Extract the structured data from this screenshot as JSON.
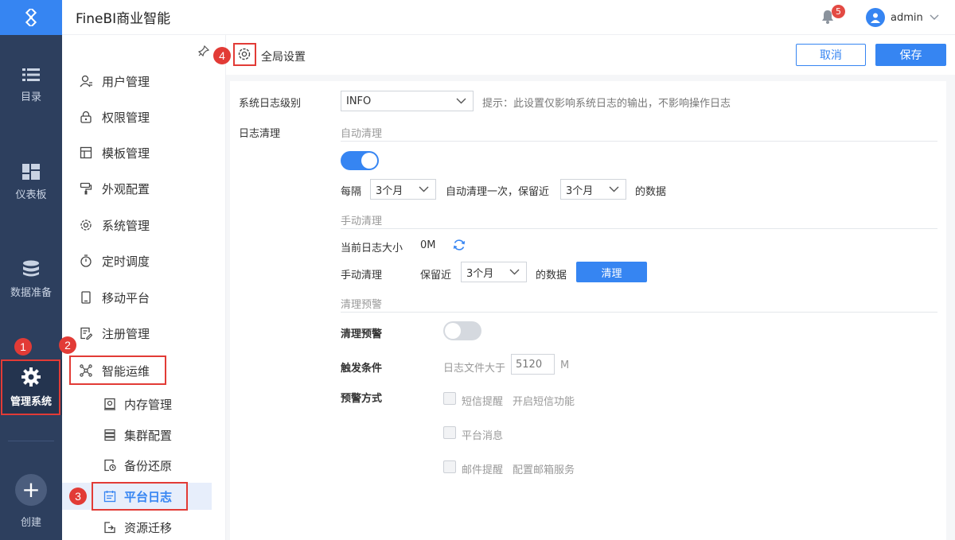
{
  "app": {
    "title": "FineBI商业智能"
  },
  "header": {
    "notifications": "5",
    "user": "admin"
  },
  "rail": {
    "items": [
      {
        "label": "目录"
      },
      {
        "label": "仪表板"
      },
      {
        "label": "数据准备"
      },
      {
        "label": "管理系统"
      },
      {
        "label": "创建"
      }
    ]
  },
  "sidebar": {
    "items": [
      {
        "label": "用户管理"
      },
      {
        "label": "权限管理"
      },
      {
        "label": "模板管理"
      },
      {
        "label": "外观配置"
      },
      {
        "label": "系统管理"
      },
      {
        "label": "定时调度"
      },
      {
        "label": "移动平台"
      },
      {
        "label": "注册管理"
      },
      {
        "label": "智能运维"
      }
    ],
    "subitems": [
      {
        "label": "内存管理"
      },
      {
        "label": "集群配置"
      },
      {
        "label": "备份还原"
      },
      {
        "label": "平台日志"
      },
      {
        "label": "资源迁移"
      }
    ]
  },
  "annotations": [
    "1",
    "2",
    "3",
    "4"
  ],
  "content": {
    "title": "全局设置",
    "cancel": "取消",
    "save": "保存",
    "log_level_label": "系统日志级别",
    "log_level_value": "INFO",
    "log_level_hint": "提示：此设置仅影响系统日志的输出，不影响操作日志",
    "log_clean_label": "日志清理",
    "auto_clean": {
      "section": "自动清理",
      "enabled": true,
      "every_label": "每隔",
      "every_value": "3个月",
      "middle_text": "自动清理一次，保留近",
      "keep_value": "3个月",
      "suffix": "的数据"
    },
    "manual_clean": {
      "section": "手动清理",
      "size_label": "当前日志大小",
      "size_value": "0M",
      "row_label": "手动清理",
      "keep_label": "保留近",
      "keep_value": "3个月",
      "suffix": "的数据",
      "button": "清理"
    },
    "warning": {
      "section": "清理预警",
      "toggle_label": "清理预警",
      "enabled": false,
      "trigger_label": "触发条件",
      "trigger_text": "日志文件大于",
      "trigger_value": "5120",
      "trigger_unit": "M",
      "method_label": "预警方式",
      "methods": [
        {
          "label": "短信提醒",
          "extra": "开启短信功能"
        },
        {
          "label": "平台消息",
          "extra": ""
        },
        {
          "label": "邮件提醒",
          "extra": "配置邮箱服务"
        }
      ]
    }
  }
}
